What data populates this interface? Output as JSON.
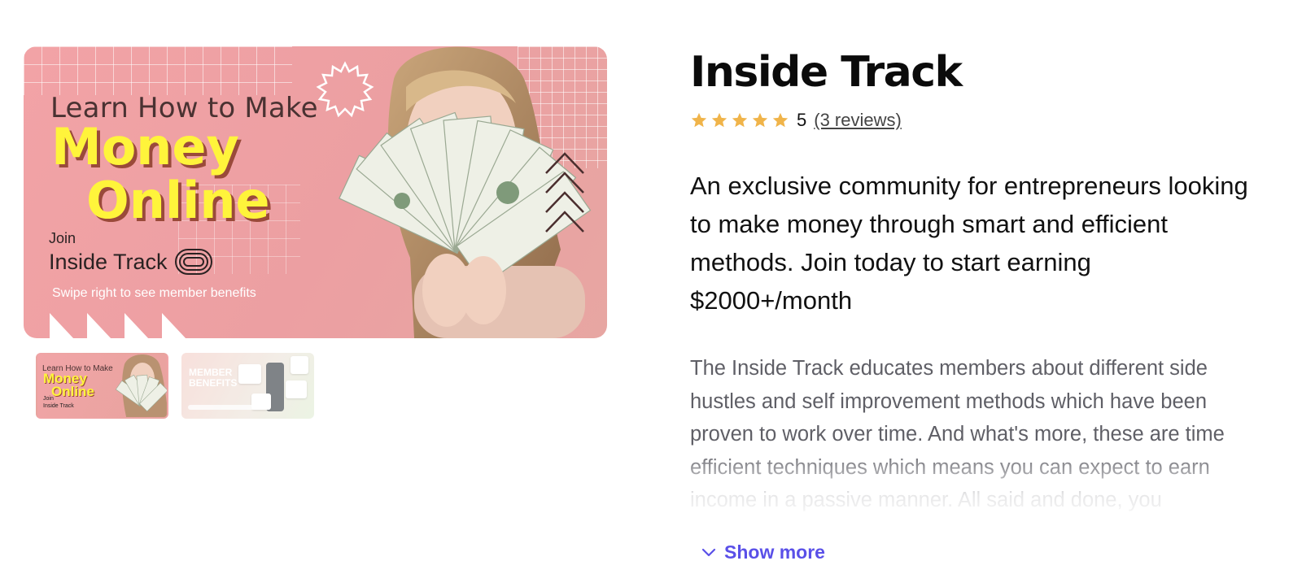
{
  "product": {
    "title": "Inside Track",
    "rating": {
      "stars": 5,
      "score": "5",
      "reviews_link": "(3 reviews)"
    },
    "tagline": "An exclusive community for entrepreneurs looking to make money through smart and efficient methods. Join today to start earning $2000+/month",
    "description": "The Inside Track educates members about different side hustles and self improvement methods which have been proven to work over time. And what's more, these are time efficient techniques which means you can expect to earn income in a passive manner. All said and done, you",
    "show_more_label": "Show more"
  },
  "hero": {
    "line1": "Learn How to Make",
    "line2": "Money",
    "line3": "Online",
    "join": "Join",
    "brand": "Inside Track",
    "swipe": "Swipe right to see member benefits"
  },
  "thumbnails": [
    {
      "line1": "Learn How to Make",
      "line2": "Money",
      "line3": "Online",
      "join": "Join",
      "brand": "Inside Track"
    },
    {
      "title_line1": "MEMBER",
      "title_line2": "BENEFITS"
    }
  ],
  "colors": {
    "accent": "#5a50e8",
    "star": "#f0b44a",
    "hero_pink": "#ef9fa3",
    "hero_yellow": "#fff43b"
  }
}
